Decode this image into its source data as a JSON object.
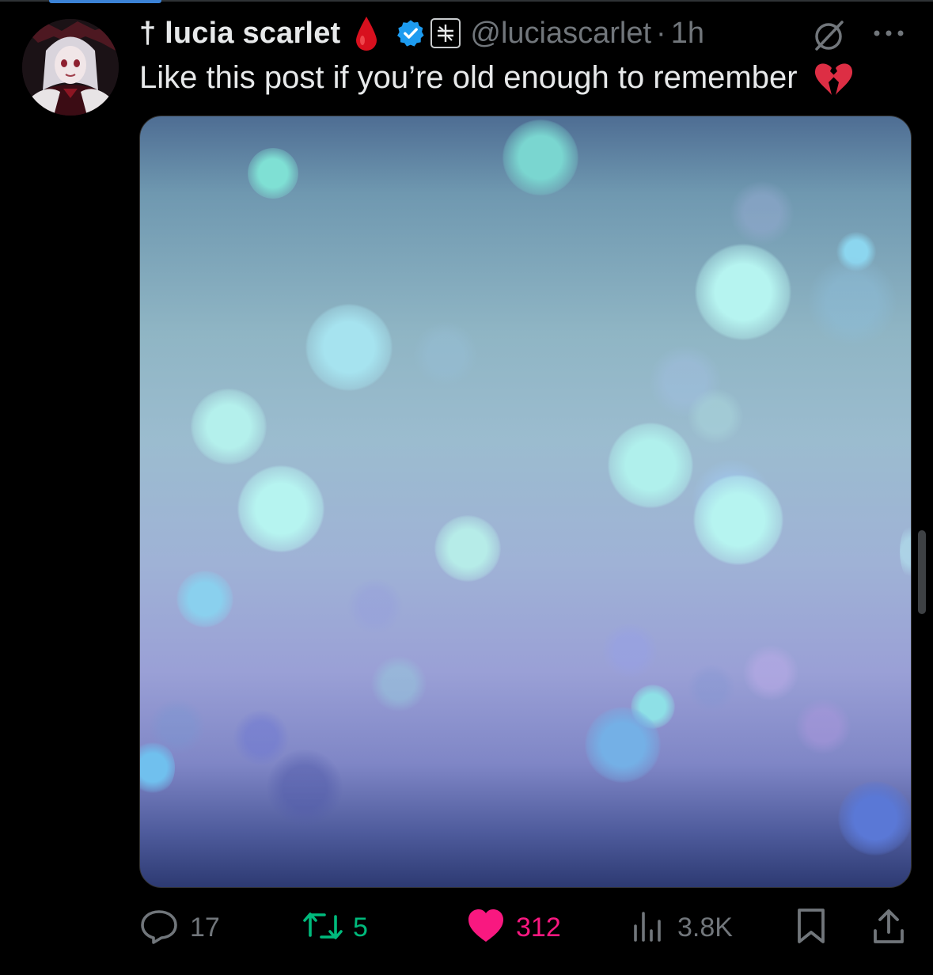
{
  "post": {
    "display_name": "† lucia scarlet",
    "handle": "@luciascarlet",
    "separator": "·",
    "time": "1h",
    "text": "Like this post if you’re old enough to remember"
  },
  "icons": {
    "avatar": "anime-avatar",
    "name_emoji": "drop-of-blood-icon",
    "verified": "verified-badge-icon",
    "affiliate": "affiliate-badge-icon",
    "grok": "grok-icon",
    "more": "more-icon",
    "text_emoji": "broken-heart-icon"
  },
  "actions": {
    "replies": "17",
    "reposts": "5",
    "likes": "312",
    "views": "3.8K"
  },
  "colors": {
    "background": "#000000",
    "text": "#e7e9ea",
    "muted": "#71767b",
    "verified": "#1d9bf0",
    "repost": "#00ba7c",
    "like": "#f91880"
  }
}
